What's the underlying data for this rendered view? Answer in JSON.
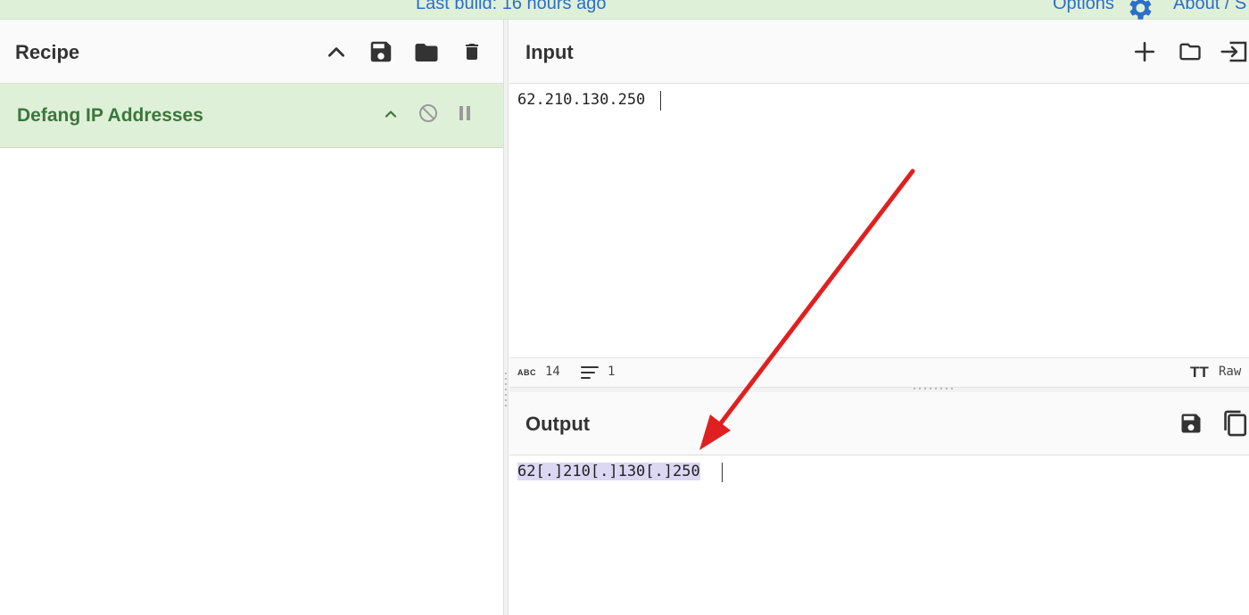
{
  "banner": {
    "build_text": "Last build: 16 hours ago",
    "options_label": "Options",
    "about_label": "About / S",
    "link_color": "#2b6fc6",
    "background": "#dff0d8"
  },
  "recipe": {
    "title": "Recipe",
    "icons": [
      "chevron-up-icon",
      "save-icon",
      "folder-icon",
      "trash-icon"
    ],
    "operations": [
      {
        "name": "Defang IP Addresses",
        "icons": [
          "chevron-up-icon",
          "disable-icon",
          "pause-icon"
        ]
      }
    ]
  },
  "input": {
    "title": "Input",
    "value": "62.210.130.250",
    "icons": [
      "plus-icon",
      "folder-icon",
      "replace-input-icon"
    ],
    "status": {
      "abc_label": "ABC",
      "length": "14",
      "lines": "1",
      "font_icon_label": "TT",
      "encoding": "Raw"
    }
  },
  "output": {
    "title": "Output",
    "value": "62[.]210[.]130[.]250",
    "highlight_color": "#dcd7f2",
    "icons": [
      "save-icon",
      "copy-icon"
    ]
  },
  "annotation": {
    "arrow_color": "#e02020"
  },
  "colors": {
    "operation_bg": "#dff0d8",
    "operation_text": "#3c763d",
    "header_bg": "#fafafa"
  }
}
